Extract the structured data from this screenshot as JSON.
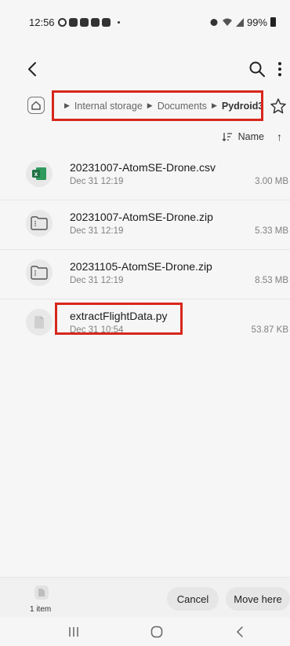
{
  "status_bar": {
    "time": "12:56",
    "battery": "99%"
  },
  "colors": {
    "highlight": "#d8261c",
    "excel_green": "#1f7244"
  },
  "breadcrumb": {
    "items": [
      "Internal storage",
      "Documents",
      "Pydroid3"
    ]
  },
  "sort": {
    "label": "Name"
  },
  "files": [
    {
      "name": "20231007-AtomSE-Drone.csv",
      "date": "Dec 31 12:19",
      "size": "3.00 MB",
      "icon": "excel-icon"
    },
    {
      "name": "20231007-AtomSE-Drone.zip",
      "date": "Dec 31 12:19",
      "size": "5.33 MB",
      "icon": "zip-icon"
    },
    {
      "name": "20231105-AtomSE-Drone.zip",
      "date": "Dec 31 12:19",
      "size": "8.53 MB",
      "icon": "zip-icon"
    },
    {
      "name": "extractFlightData.py",
      "date": "Dec 31 10:54",
      "size": "53.87 KB",
      "icon": "file-icon"
    }
  ],
  "bottom": {
    "item_count": "1 item",
    "cancel_label": "Cancel",
    "move_label": "Move here"
  }
}
